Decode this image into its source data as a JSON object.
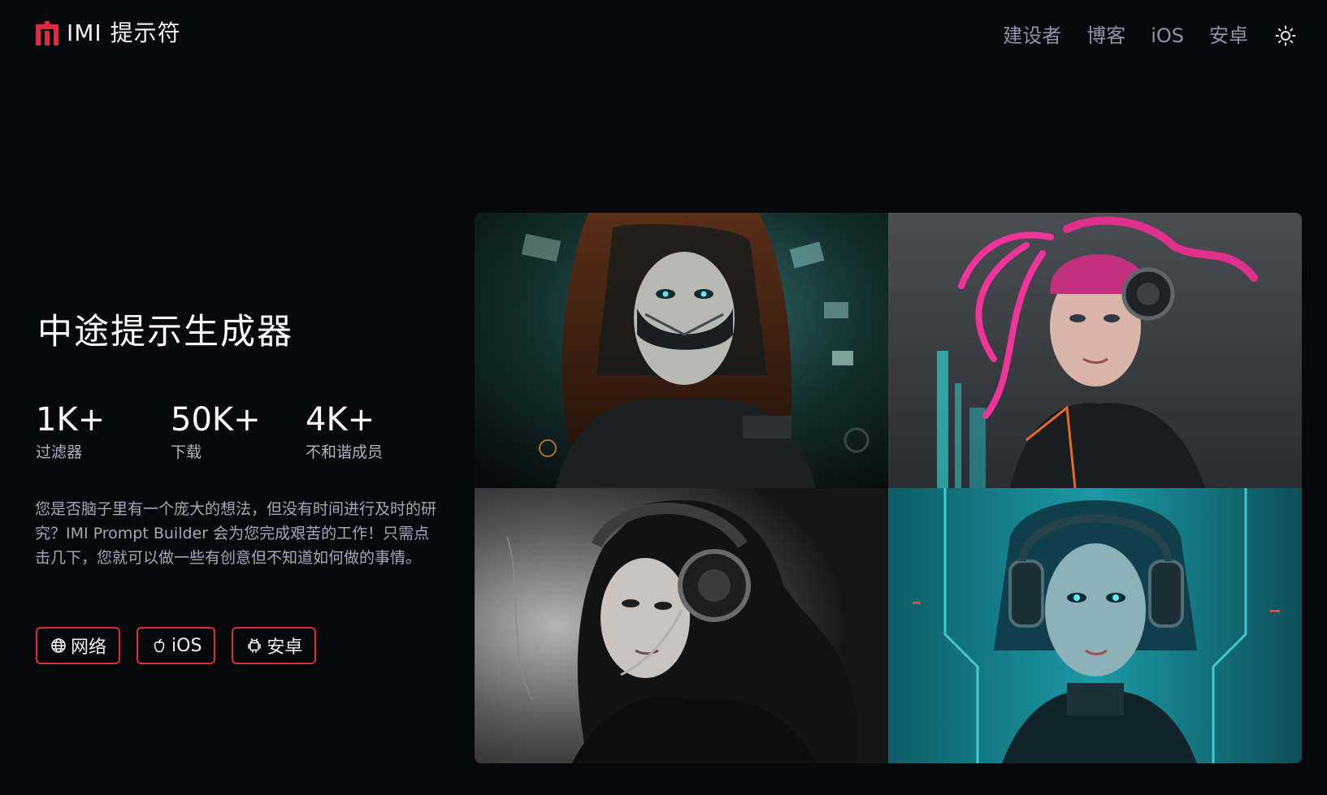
{
  "header": {
    "logo_text": "IMI 提示符",
    "nav": [
      "建设者",
      "博客",
      "iOS",
      "安卓"
    ],
    "theme_icon": "sun-icon"
  },
  "hero": {
    "title": "中途提示生成器",
    "stats": [
      {
        "value": "1K+",
        "label": "过滤器"
      },
      {
        "value": "50K+",
        "label": "下载"
      },
      {
        "value": "4K+",
        "label": "不和谐成员"
      }
    ],
    "description": "您是否脑子里有一个庞大的想法，但没有时间进行及时的研究？IMI Prompt Builder 会为您完成艰苦的工作！只需点击几下，您就可以做一些有创意但不知道如何做的事情。",
    "buttons": [
      {
        "label": "网络",
        "icon": "globe-icon"
      },
      {
        "label": "iOS",
        "icon": "apple-icon"
      },
      {
        "label": "安卓",
        "icon": "android-icon"
      }
    ]
  },
  "colors": {
    "background": "#07080c",
    "accent": "#e02b3c",
    "nav_text": "#8d93a8"
  },
  "gallery": {
    "images": [
      "cyberpunk-woman-mask-icon",
      "cyberpunk-woman-pink-hair-icon",
      "cyberpunk-woman-monochrome-icon",
      "cyberpunk-woman-cyan-icon"
    ]
  }
}
